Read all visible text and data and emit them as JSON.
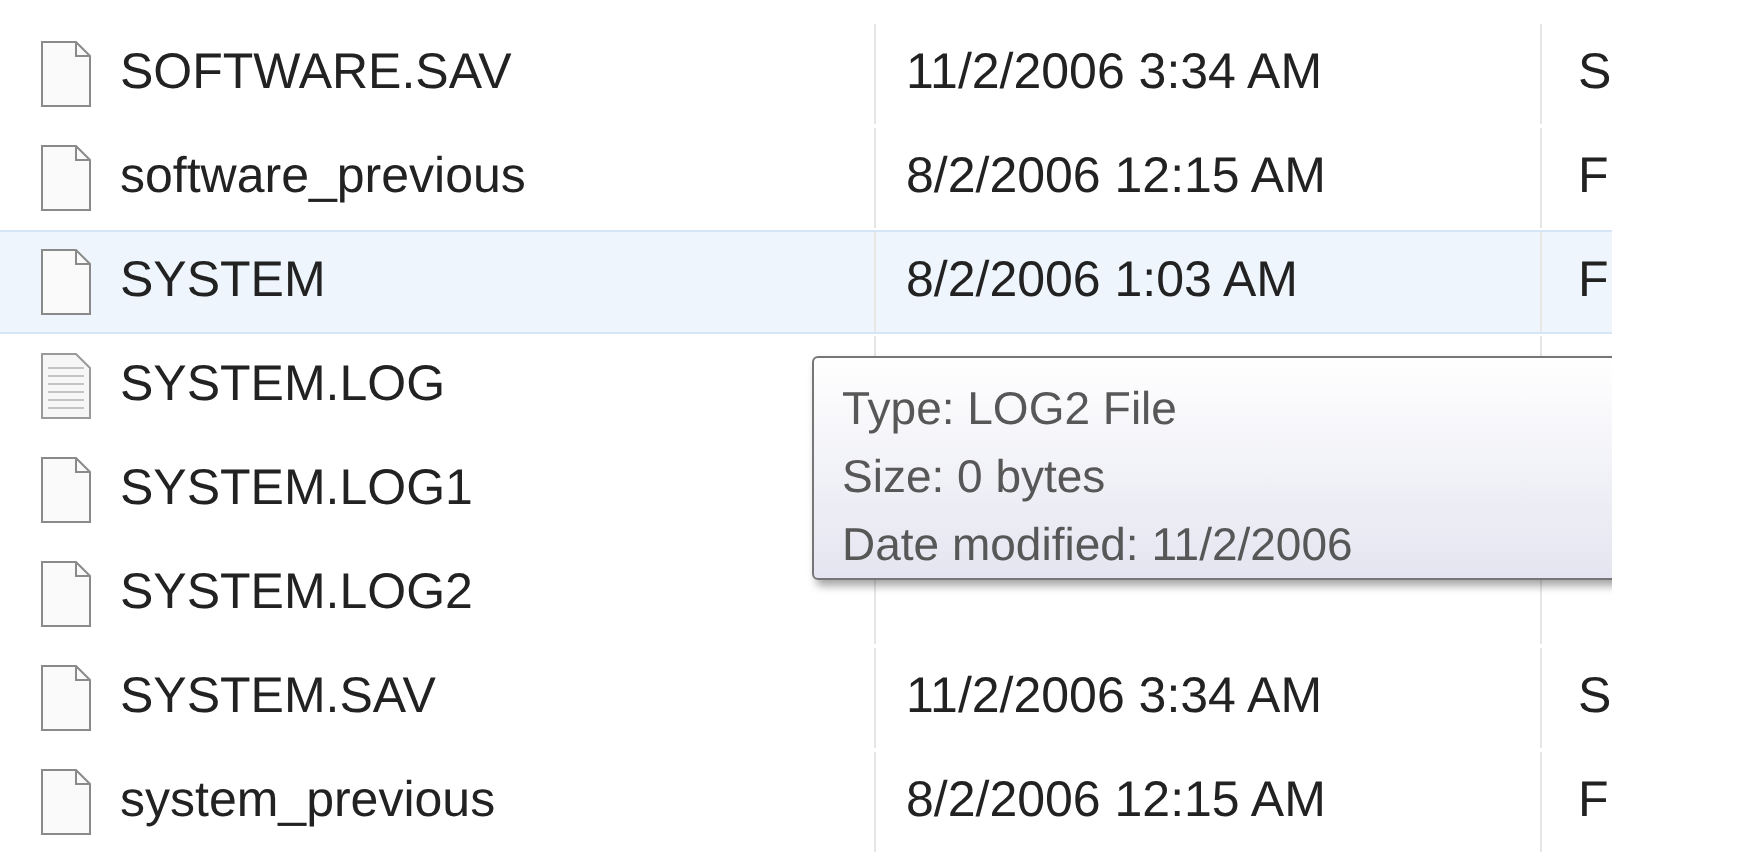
{
  "files": [
    {
      "name": "SOFTWARE.SAV",
      "kind": "blank",
      "hovered": false,
      "date": "11/2/2006 3:34 AM",
      "column_3": "S"
    },
    {
      "name": "software_previous",
      "kind": "blank",
      "hovered": false,
      "date": "8/2/2006 12:15 AM",
      "column_3": "F"
    },
    {
      "name": "SYSTEM",
      "kind": "blank",
      "hovered": true,
      "date": "8/2/2006 1:03 AM",
      "column_3": "F"
    },
    {
      "name": "SYSTEM.LOG",
      "kind": "text",
      "hovered": false
    },
    {
      "name": "SYSTEM.LOG1",
      "kind": "blank",
      "hovered": false
    },
    {
      "name": "SYSTEM.LOG2",
      "kind": "blank",
      "hovered": false
    },
    {
      "name": "SYSTEM.SAV",
      "kind": "blank",
      "hovered": false,
      "date": "11/2/2006 3:34 AM",
      "column_3": "S"
    },
    {
      "name": "system_previous",
      "kind": "blank",
      "hovered": false,
      "date": "8/2/2006 12:15 AM",
      "column_3": "F"
    }
  ],
  "tooltip": {
    "lines": [
      "Type: LOG2 File",
      "Size: 0 bytes",
      "Date modified: 11/2/2006"
    ]
  }
}
